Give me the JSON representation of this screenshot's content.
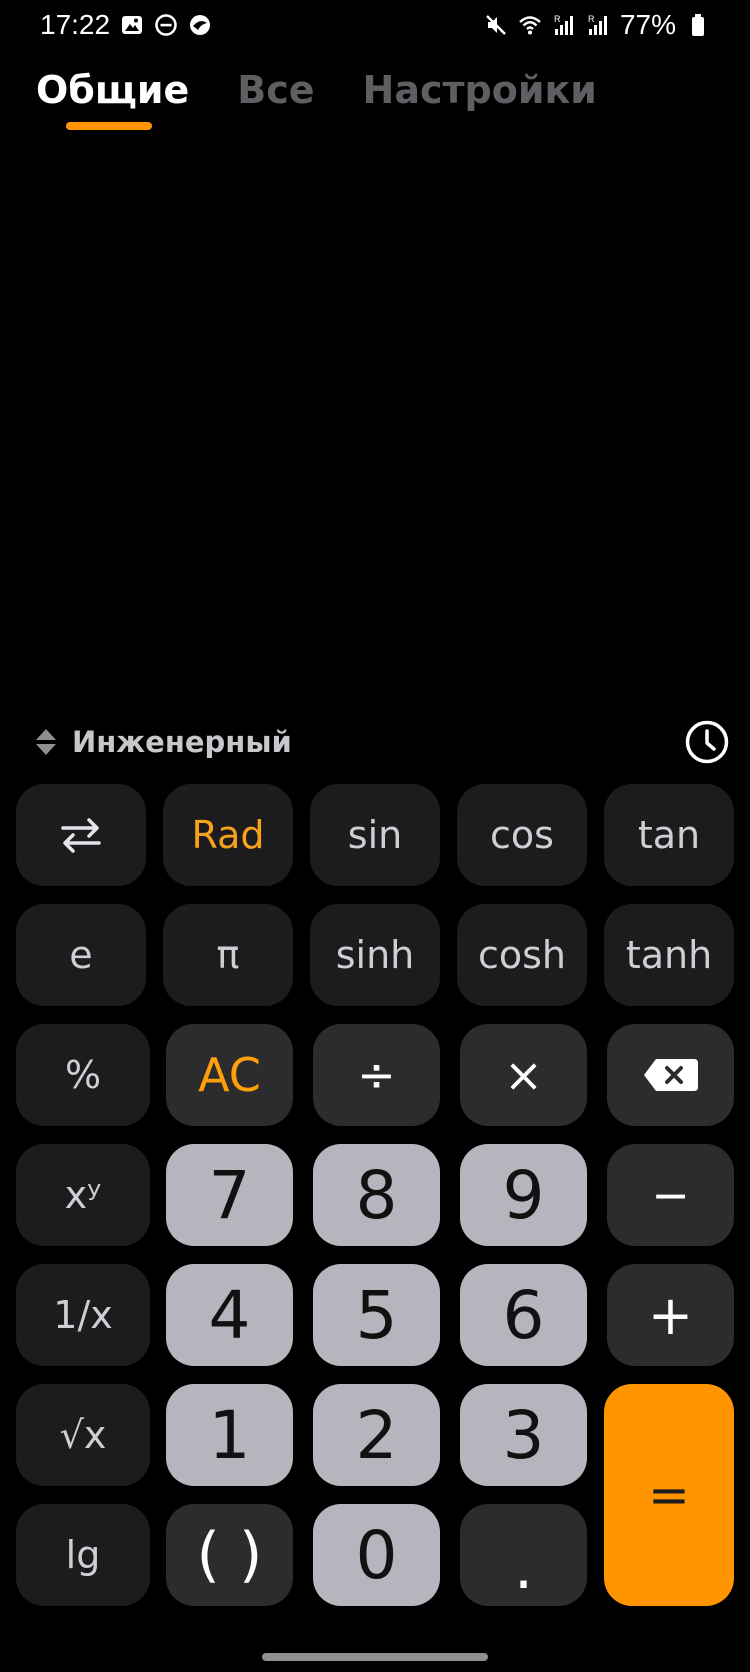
{
  "status_bar": {
    "time": "17:22",
    "battery": "77%",
    "left_icons": [
      "image-icon",
      "do-not-disturb-icon",
      "app-notification-icon"
    ],
    "right_icons": [
      "mute-icon",
      "wifi-icon",
      "signal-r-icon",
      "signal-r-icon",
      "battery-icon"
    ]
  },
  "tabs": [
    {
      "label": "Общие",
      "active": true
    },
    {
      "label": "Все",
      "active": false
    },
    {
      "label": "Настройки",
      "active": false
    }
  ],
  "mode": {
    "label": "Инженерный"
  },
  "keys": {
    "swap": "⇄",
    "rad": "Rad",
    "sin": "sin",
    "cos": "cos",
    "tan": "tan",
    "e": "e",
    "pi": "π",
    "sinh": "sinh",
    "cosh": "cosh",
    "tanh": "tanh",
    "percent": "%",
    "ac": "AC",
    "divide": "÷",
    "multiply": "×",
    "pow": "xʸ",
    "seven": "7",
    "eight": "8",
    "nine": "9",
    "minus": "−",
    "reciprocal": "1/x",
    "four": "4",
    "five": "5",
    "six": "6",
    "plus": "+",
    "sqrt": "√x",
    "one": "1",
    "two": "2",
    "three": "3",
    "equals": "=",
    "lg": "lg",
    "parens": "( )",
    "zero": "0",
    "dot": "."
  },
  "colors": {
    "accent": "#ff9500",
    "background": "#000000",
    "number_key": "#b5b6bd",
    "sci_key": "#1c1c1e",
    "op_key": "#2c2c2e"
  }
}
